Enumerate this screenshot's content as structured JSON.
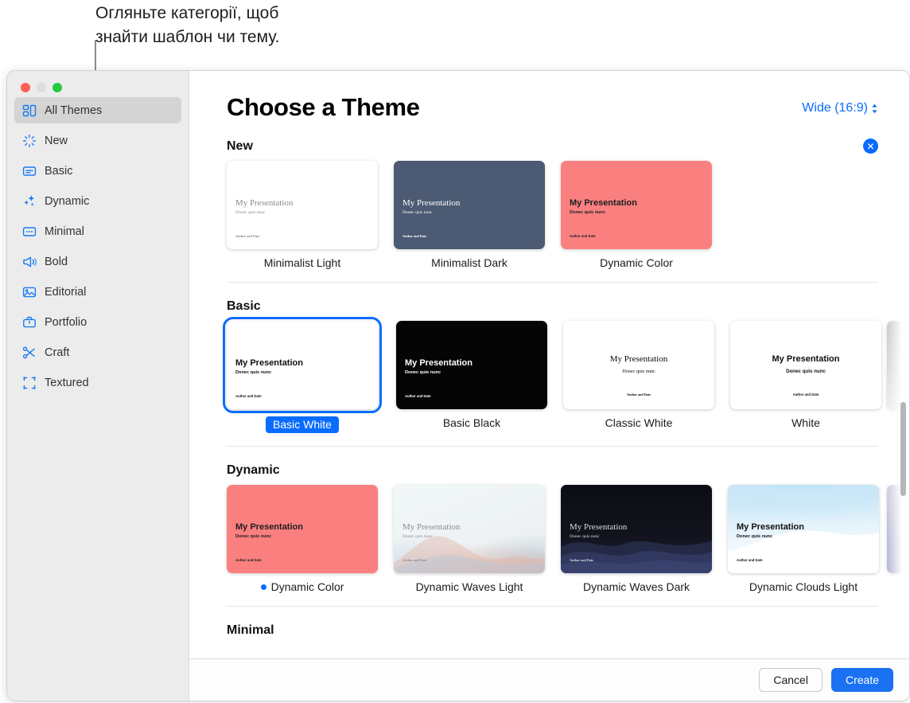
{
  "callout": {
    "text": "Огляньте категорії, щоб\nзнайти шаблон чи тему."
  },
  "window": {
    "traffic": {
      "close": "close",
      "minimize": "minimize",
      "zoom": "zoom"
    }
  },
  "sidebar": {
    "items": [
      {
        "label": "All Themes",
        "icon": "all-themes-icon",
        "active": true
      },
      {
        "label": "New",
        "icon": "sparkle-burst-icon",
        "active": false
      },
      {
        "label": "Basic",
        "icon": "basic-card-icon",
        "active": false
      },
      {
        "label": "Dynamic",
        "icon": "sparkles-icon",
        "active": false
      },
      {
        "label": "Minimal",
        "icon": "minimal-dots-icon",
        "active": false
      },
      {
        "label": "Bold",
        "icon": "megaphone-icon",
        "active": false
      },
      {
        "label": "Editorial",
        "icon": "photo-icon",
        "active": false
      },
      {
        "label": "Portfolio",
        "icon": "briefcase-icon",
        "active": false
      },
      {
        "label": "Craft",
        "icon": "scissors-icon",
        "active": false
      },
      {
        "label": "Textured",
        "icon": "crop-frame-icon",
        "active": false
      }
    ]
  },
  "header": {
    "title": "Choose a Theme",
    "ratio_label": "Wide (16:9)",
    "ratio_icon": "chevron-up-down-icon"
  },
  "slide_text": {
    "title": "My Presentation",
    "subtitle": "Donec quis nunc",
    "footer": "Author and Date"
  },
  "sections": [
    {
      "heading": "New",
      "has_close_badge": true,
      "close_badge_icon": "close-circle-icon",
      "has_peek": false,
      "themes": [
        {
          "name": "Minimalist Light",
          "style": "bg-white",
          "text": "#8a8a8e",
          "font": "serif",
          "selected": false,
          "dot": false
        },
        {
          "name": "Minimalist Dark",
          "style": "bg-slate",
          "text": "#ffffff",
          "font": "serif",
          "selected": false,
          "dot": false
        },
        {
          "name": "Dynamic Color",
          "style": "bg-coral",
          "text": "#1d1d1f",
          "font": "sans",
          "selected": false,
          "dot": false
        }
      ]
    },
    {
      "heading": "Basic",
      "has_close_badge": false,
      "has_peek": true,
      "peek_style": "bg-peek-gray",
      "themes": [
        {
          "name": "Basic White",
          "style": "bg-white",
          "text": "#101012",
          "font": "sans",
          "selected": true,
          "dot": false
        },
        {
          "name": "Basic Black",
          "style": "bg-black",
          "text": "#ffffff",
          "font": "sans",
          "selected": false,
          "dot": false
        },
        {
          "name": "Classic White",
          "style": "bg-white",
          "text": "#0b0b0d",
          "font": "serif",
          "selected": false,
          "dot": false,
          "center": true
        },
        {
          "name": "White",
          "style": "bg-white",
          "text": "#101012",
          "font": "sans",
          "selected": false,
          "dot": false,
          "center": true
        }
      ]
    },
    {
      "heading": "Dynamic",
      "has_close_badge": false,
      "has_peek": true,
      "peek_style": "bg-peek-violet",
      "themes": [
        {
          "name": "Dynamic Color",
          "style": "bg-coral",
          "text": "#1d1d1f",
          "font": "sans",
          "selected": false,
          "dot": true
        },
        {
          "name": "Dynamic Waves Light",
          "style": "bg-waves-light",
          "text": "#8c8c92",
          "font": "serif",
          "selected": false,
          "dot": false
        },
        {
          "name": "Dynamic Waves Dark",
          "style": "bg-waves-dark",
          "text": "#dcdce2",
          "font": "serif",
          "selected": false,
          "dot": false
        },
        {
          "name": "Dynamic Clouds Light",
          "style": "bg-clouds-light",
          "text": "#111114",
          "font": "sans",
          "selected": false,
          "dot": false
        }
      ]
    },
    {
      "heading": "Minimal",
      "has_close_badge": false,
      "has_peek": false,
      "themes": []
    }
  ],
  "footer": {
    "cancel_label": "Cancel",
    "create_label": "Create"
  }
}
